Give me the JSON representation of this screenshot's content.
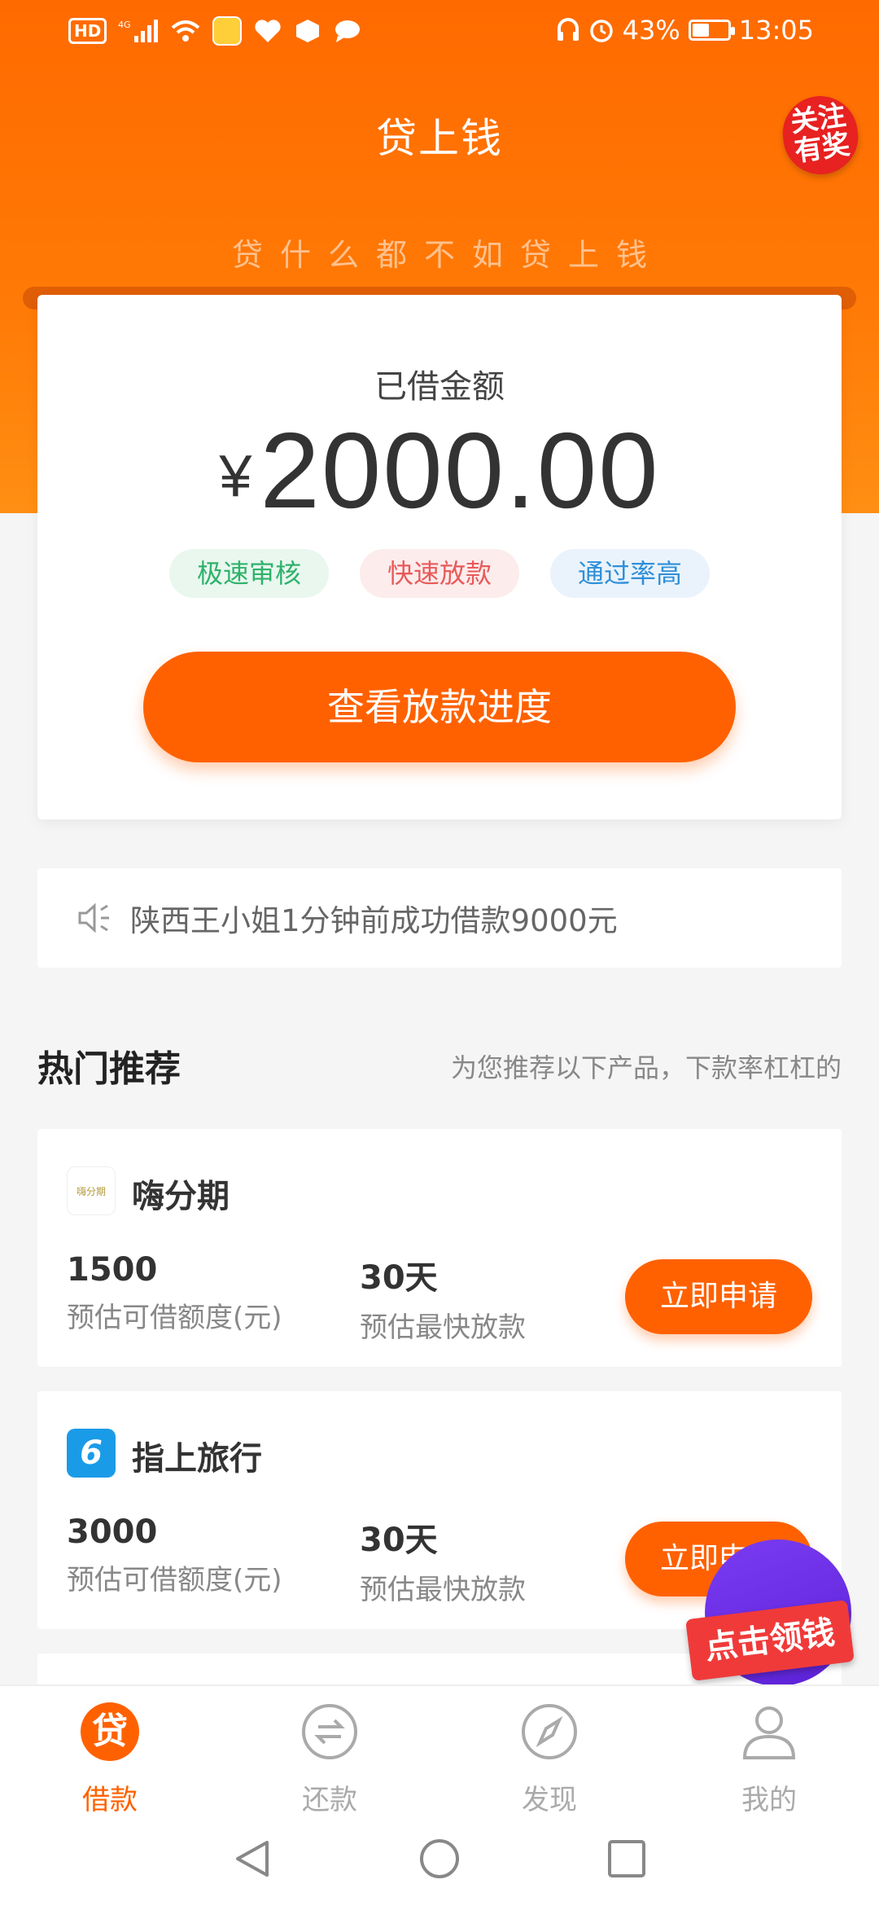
{
  "status_bar": {
    "network": "4G",
    "hd": "HD",
    "battery_text": "43%",
    "battery_level": 0.43,
    "time": "13:05"
  },
  "header": {
    "title": "贷上钱",
    "follow_badge": "关注有奖",
    "slogan": "贷什么都不如贷上钱"
  },
  "loan_card": {
    "label": "已借金额",
    "currency": "¥",
    "amount": "2000.00",
    "tags": [
      "极速审核",
      "快速放款",
      "通过率高"
    ],
    "progress_button": "查看放款进度"
  },
  "notice": {
    "text": "陕西王小姐1分钟前成功借款9000元"
  },
  "recommend": {
    "title": "热门推荐",
    "subtitle": "为您推荐以下产品，下款率杠杠的",
    "products": [
      {
        "name": "嗨分期",
        "logo_text": "嗨分期",
        "amount": "1500",
        "amount_label": "预估可借额度(元)",
        "days": "30天",
        "days_label": "预估最快放款",
        "button": "立即申请"
      },
      {
        "name": "指上旅行",
        "logo_text": "6",
        "amount": "3000",
        "amount_label": "预估可借额度(元)",
        "days": "30天",
        "days_label": "预估最快放款",
        "button": "立即申请"
      }
    ]
  },
  "promo": {
    "label": "点击领钱"
  },
  "tabbar": {
    "items": [
      {
        "label": "借款",
        "icon": "贷",
        "active": true
      },
      {
        "label": "还款",
        "icon": "exchange-icon",
        "active": false
      },
      {
        "label": "发现",
        "icon": "compass-icon",
        "active": false
      },
      {
        "label": "我的",
        "icon": "user-icon",
        "active": false
      }
    ]
  },
  "colors": {
    "brand": "#ff6100",
    "header_bg": "#ff6a00"
  }
}
